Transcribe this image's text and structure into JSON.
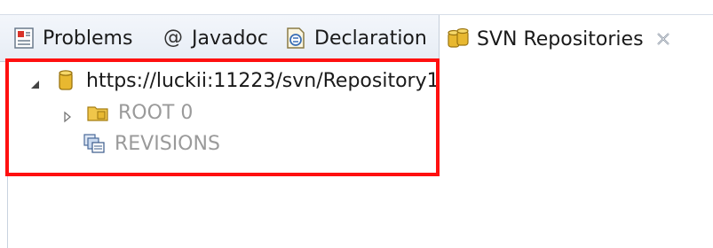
{
  "tabs": {
    "problems": {
      "label": "Problems",
      "icon": "problems-icon"
    },
    "javadoc": {
      "label": "Javadoc",
      "icon": "at-sign-icon"
    },
    "declaration": {
      "label": "Declaration",
      "icon": "declaration-icon"
    },
    "svn_repositories": {
      "label": "SVN Repositories",
      "icon": "svn-repository-icon",
      "active": true,
      "close_icon": "close-icon"
    }
  },
  "tree": {
    "repository": {
      "label": "https://luckii:11223/svn/Repository1",
      "expanded": true,
      "icon": "repository-cylinder-icon"
    },
    "root": {
      "label": "ROOT 0",
      "expanded": false,
      "icon": "folder-icon"
    },
    "revisions": {
      "label": "REVISIONS",
      "icon": "revisions-icon"
    }
  },
  "colors": {
    "highlight": "#ff1010",
    "dimmed_text": "#9a9a9a",
    "repository_gold": "#e8b830"
  }
}
